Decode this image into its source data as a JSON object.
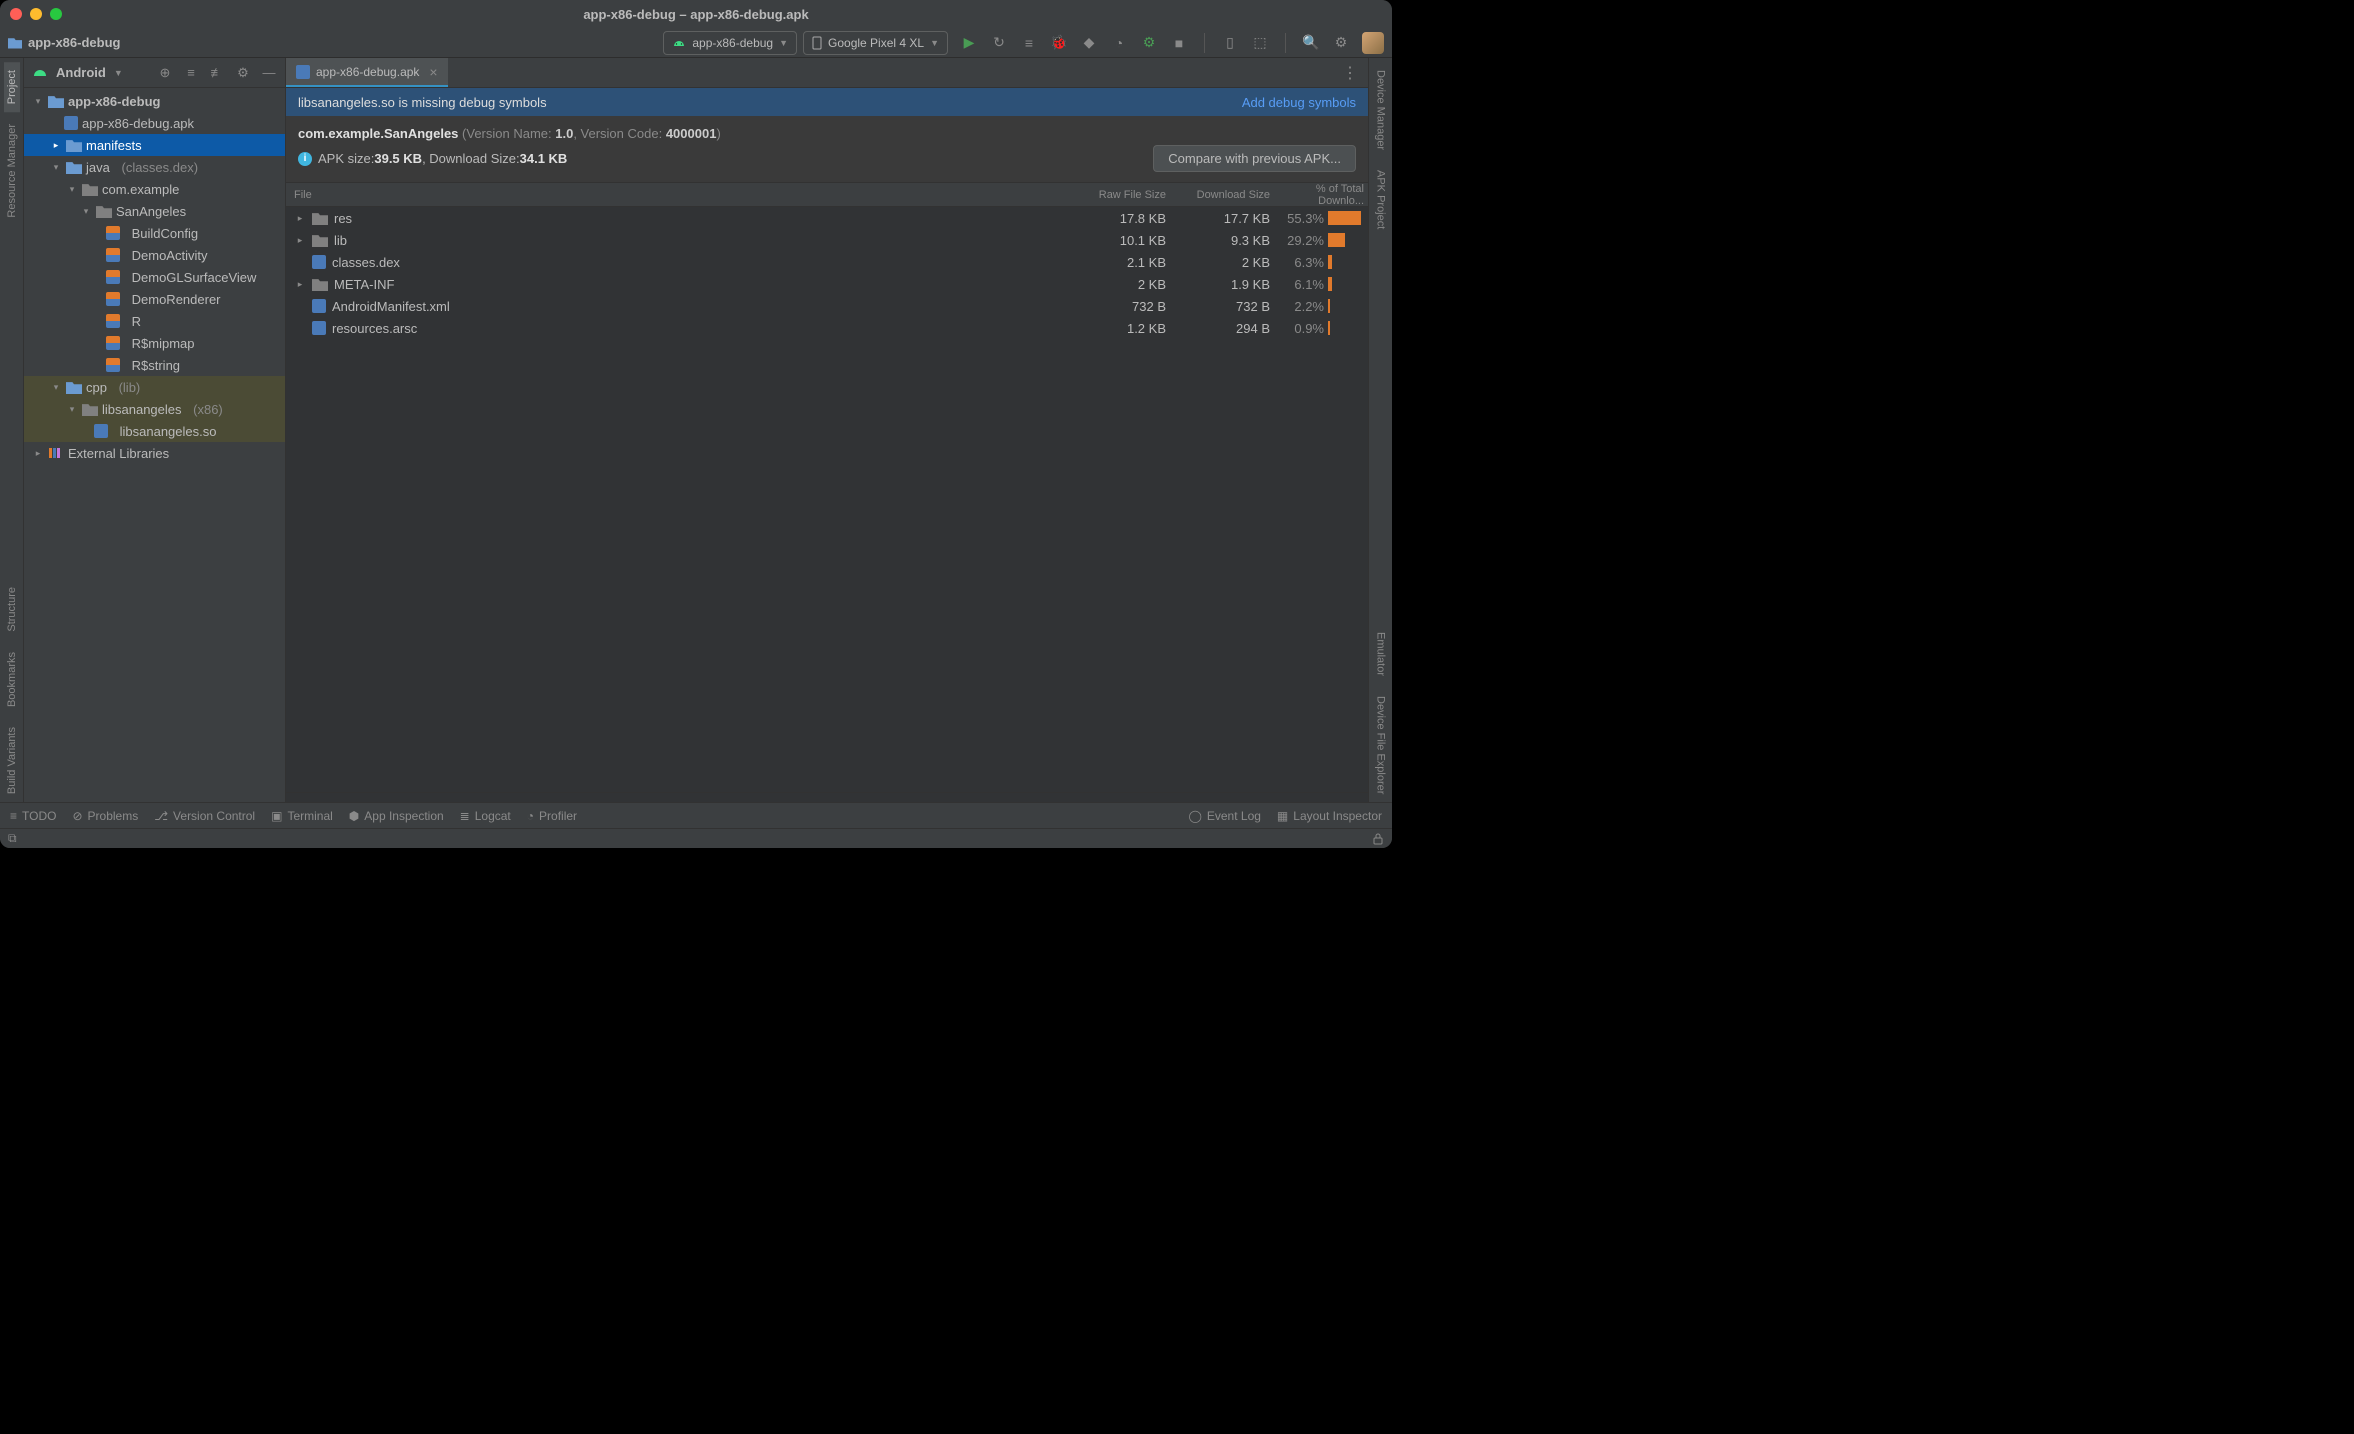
{
  "window": {
    "title": "app-x86-debug – app-x86-debug.apk"
  },
  "breadcrumb": "app-x86-debug",
  "toolbar": {
    "run_config": "app-x86-debug",
    "device": "Google Pixel 4 XL"
  },
  "sidebar": {
    "mode": "Android",
    "tree": {
      "root": "app-x86-debug",
      "apk": "app-x86-debug.apk",
      "manifests": "manifests",
      "java": "java",
      "java_hint": "(classes.dex)",
      "pkg": "com.example",
      "cls": "SanAngeles",
      "k1": "BuildConfig",
      "k2": "DemoActivity",
      "k3": "DemoGLSurfaceView",
      "k4": "DemoRenderer",
      "k5": "R",
      "k6": "R$mipmap",
      "k7": "R$string",
      "cpp": "cpp",
      "cpp_hint": "(lib)",
      "lib": "libsanangeles",
      "lib_hint": "(x86)",
      "so": "libsanangeles.so",
      "ext": "External Libraries"
    }
  },
  "left_tabs": {
    "project": "Project",
    "resmgr": "Resource Manager",
    "struct": "Structure",
    "bookmarks": "Bookmarks",
    "bv": "Build Variants"
  },
  "right_tabs": {
    "devmgr": "Device Manager",
    "apkproj": "APK Project",
    "emu": "Emulator",
    "dfe": "Device File Explorer"
  },
  "editor": {
    "tab": "app-x86-debug.apk",
    "banner_msg": "libsanangeles.so is missing debug symbols",
    "banner_link": "Add debug symbols",
    "pkg": "com.example.SanAngeles",
    "ver_label": "(Version Name: ",
    "ver_name": "1.0",
    "ver_mid": ", Version Code: ",
    "ver_code": "4000001",
    "ver_end": ")",
    "size_pre": "APK size: ",
    "apk_size": "39.5 KB",
    "size_mid": ", Download Size: ",
    "dl_size": "34.1 KB",
    "compare_btn": "Compare with previous APK...",
    "cols": {
      "file": "File",
      "raw": "Raw File Size",
      "dl": "Download Size",
      "pct": "% of Total Downlo..."
    },
    "rows": [
      {
        "exp": true,
        "icon": "folder",
        "name": "res",
        "raw": "17.8 KB",
        "dl": "17.7 KB",
        "pct": "55.3%",
        "bar": 55
      },
      {
        "exp": true,
        "icon": "folder",
        "name": "lib",
        "raw": "10.1 KB",
        "dl": "9.3 KB",
        "pct": "29.2%",
        "bar": 29
      },
      {
        "exp": false,
        "icon": "dex",
        "name": "classes.dex",
        "raw": "2.1 KB",
        "dl": "2 KB",
        "pct": "6.3%",
        "bar": 6
      },
      {
        "exp": true,
        "icon": "folder",
        "name": "META-INF",
        "raw": "2 KB",
        "dl": "1.9 KB",
        "pct": "6.1%",
        "bar": 6
      },
      {
        "exp": false,
        "icon": "xml",
        "name": "AndroidManifest.xml",
        "raw": "732 B",
        "dl": "732 B",
        "pct": "2.2%",
        "bar": 3
      },
      {
        "exp": false,
        "icon": "arsc",
        "name": "resources.arsc",
        "raw": "1.2 KB",
        "dl": "294 B",
        "pct": "0.9%",
        "bar": 2
      }
    ]
  },
  "statusbar": {
    "todo": "TODO",
    "problems": "Problems",
    "vc": "Version Control",
    "terminal": "Terminal",
    "appinsp": "App Inspection",
    "logcat": "Logcat",
    "profiler": "Profiler",
    "eventlog": "Event Log",
    "layout": "Layout Inspector"
  }
}
